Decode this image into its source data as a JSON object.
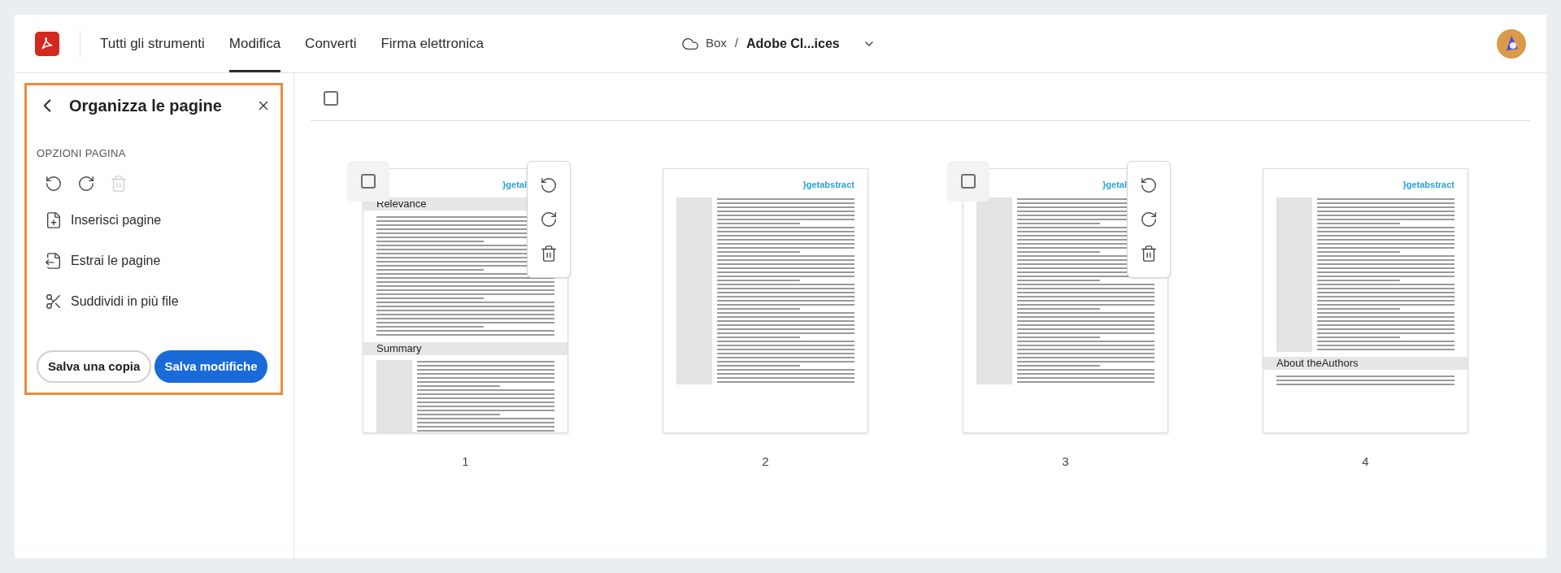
{
  "topbar": {
    "tabs": [
      {
        "label": "Tutti gli strumenti",
        "selected": false
      },
      {
        "label": "Modifica",
        "selected": true
      },
      {
        "label": "Converti",
        "selected": false
      },
      {
        "label": "Firma elettronica",
        "selected": false
      }
    ],
    "location": {
      "service": "Box",
      "separator": "/",
      "file": "Adobe Cl...ices"
    }
  },
  "panel": {
    "title": "Organizza le pagine",
    "section": "OPZIONI PAGINA",
    "actions": [
      {
        "kind": "rotate-left",
        "disabled": false
      },
      {
        "kind": "rotate-right",
        "disabled": false
      },
      {
        "kind": "delete",
        "disabled": true
      }
    ],
    "items": [
      {
        "kind": "insert",
        "label": "Inserisci pagine"
      },
      {
        "kind": "extract",
        "label": "Estrai le pagine"
      },
      {
        "kind": "split",
        "label": "Suddividi in più file"
      }
    ],
    "buttons": [
      {
        "kind": "secondary",
        "label": "Salva una copia"
      },
      {
        "kind": "primary",
        "label": "Salva modifiche"
      }
    ]
  },
  "select_all": {
    "checked": false
  },
  "pages": [
    {
      "number": "1",
      "hovered": true,
      "checked": false,
      "logo": "}getal",
      "blocks": [
        {
          "kind": "heading",
          "text": "Relevance"
        },
        {
          "kind": "body"
        },
        {
          "kind": "heading",
          "text": "Summary"
        },
        {
          "kind": "body-sidebar"
        }
      ]
    },
    {
      "number": "2",
      "hovered": false,
      "logo": "}getabstract",
      "blocks": [
        {
          "kind": "body-sidebar"
        }
      ]
    },
    {
      "number": "3",
      "hovered": true,
      "checked": false,
      "logo": "}getal",
      "blocks": [
        {
          "kind": "body-sidebar"
        }
      ]
    },
    {
      "number": "4",
      "hovered": false,
      "logo": "}getabstract",
      "blocks": [
        {
          "kind": "body-sidebar"
        },
        {
          "kind": "heading",
          "text": "About theAuthors"
        },
        {
          "kind": "body"
        }
      ]
    }
  ]
}
